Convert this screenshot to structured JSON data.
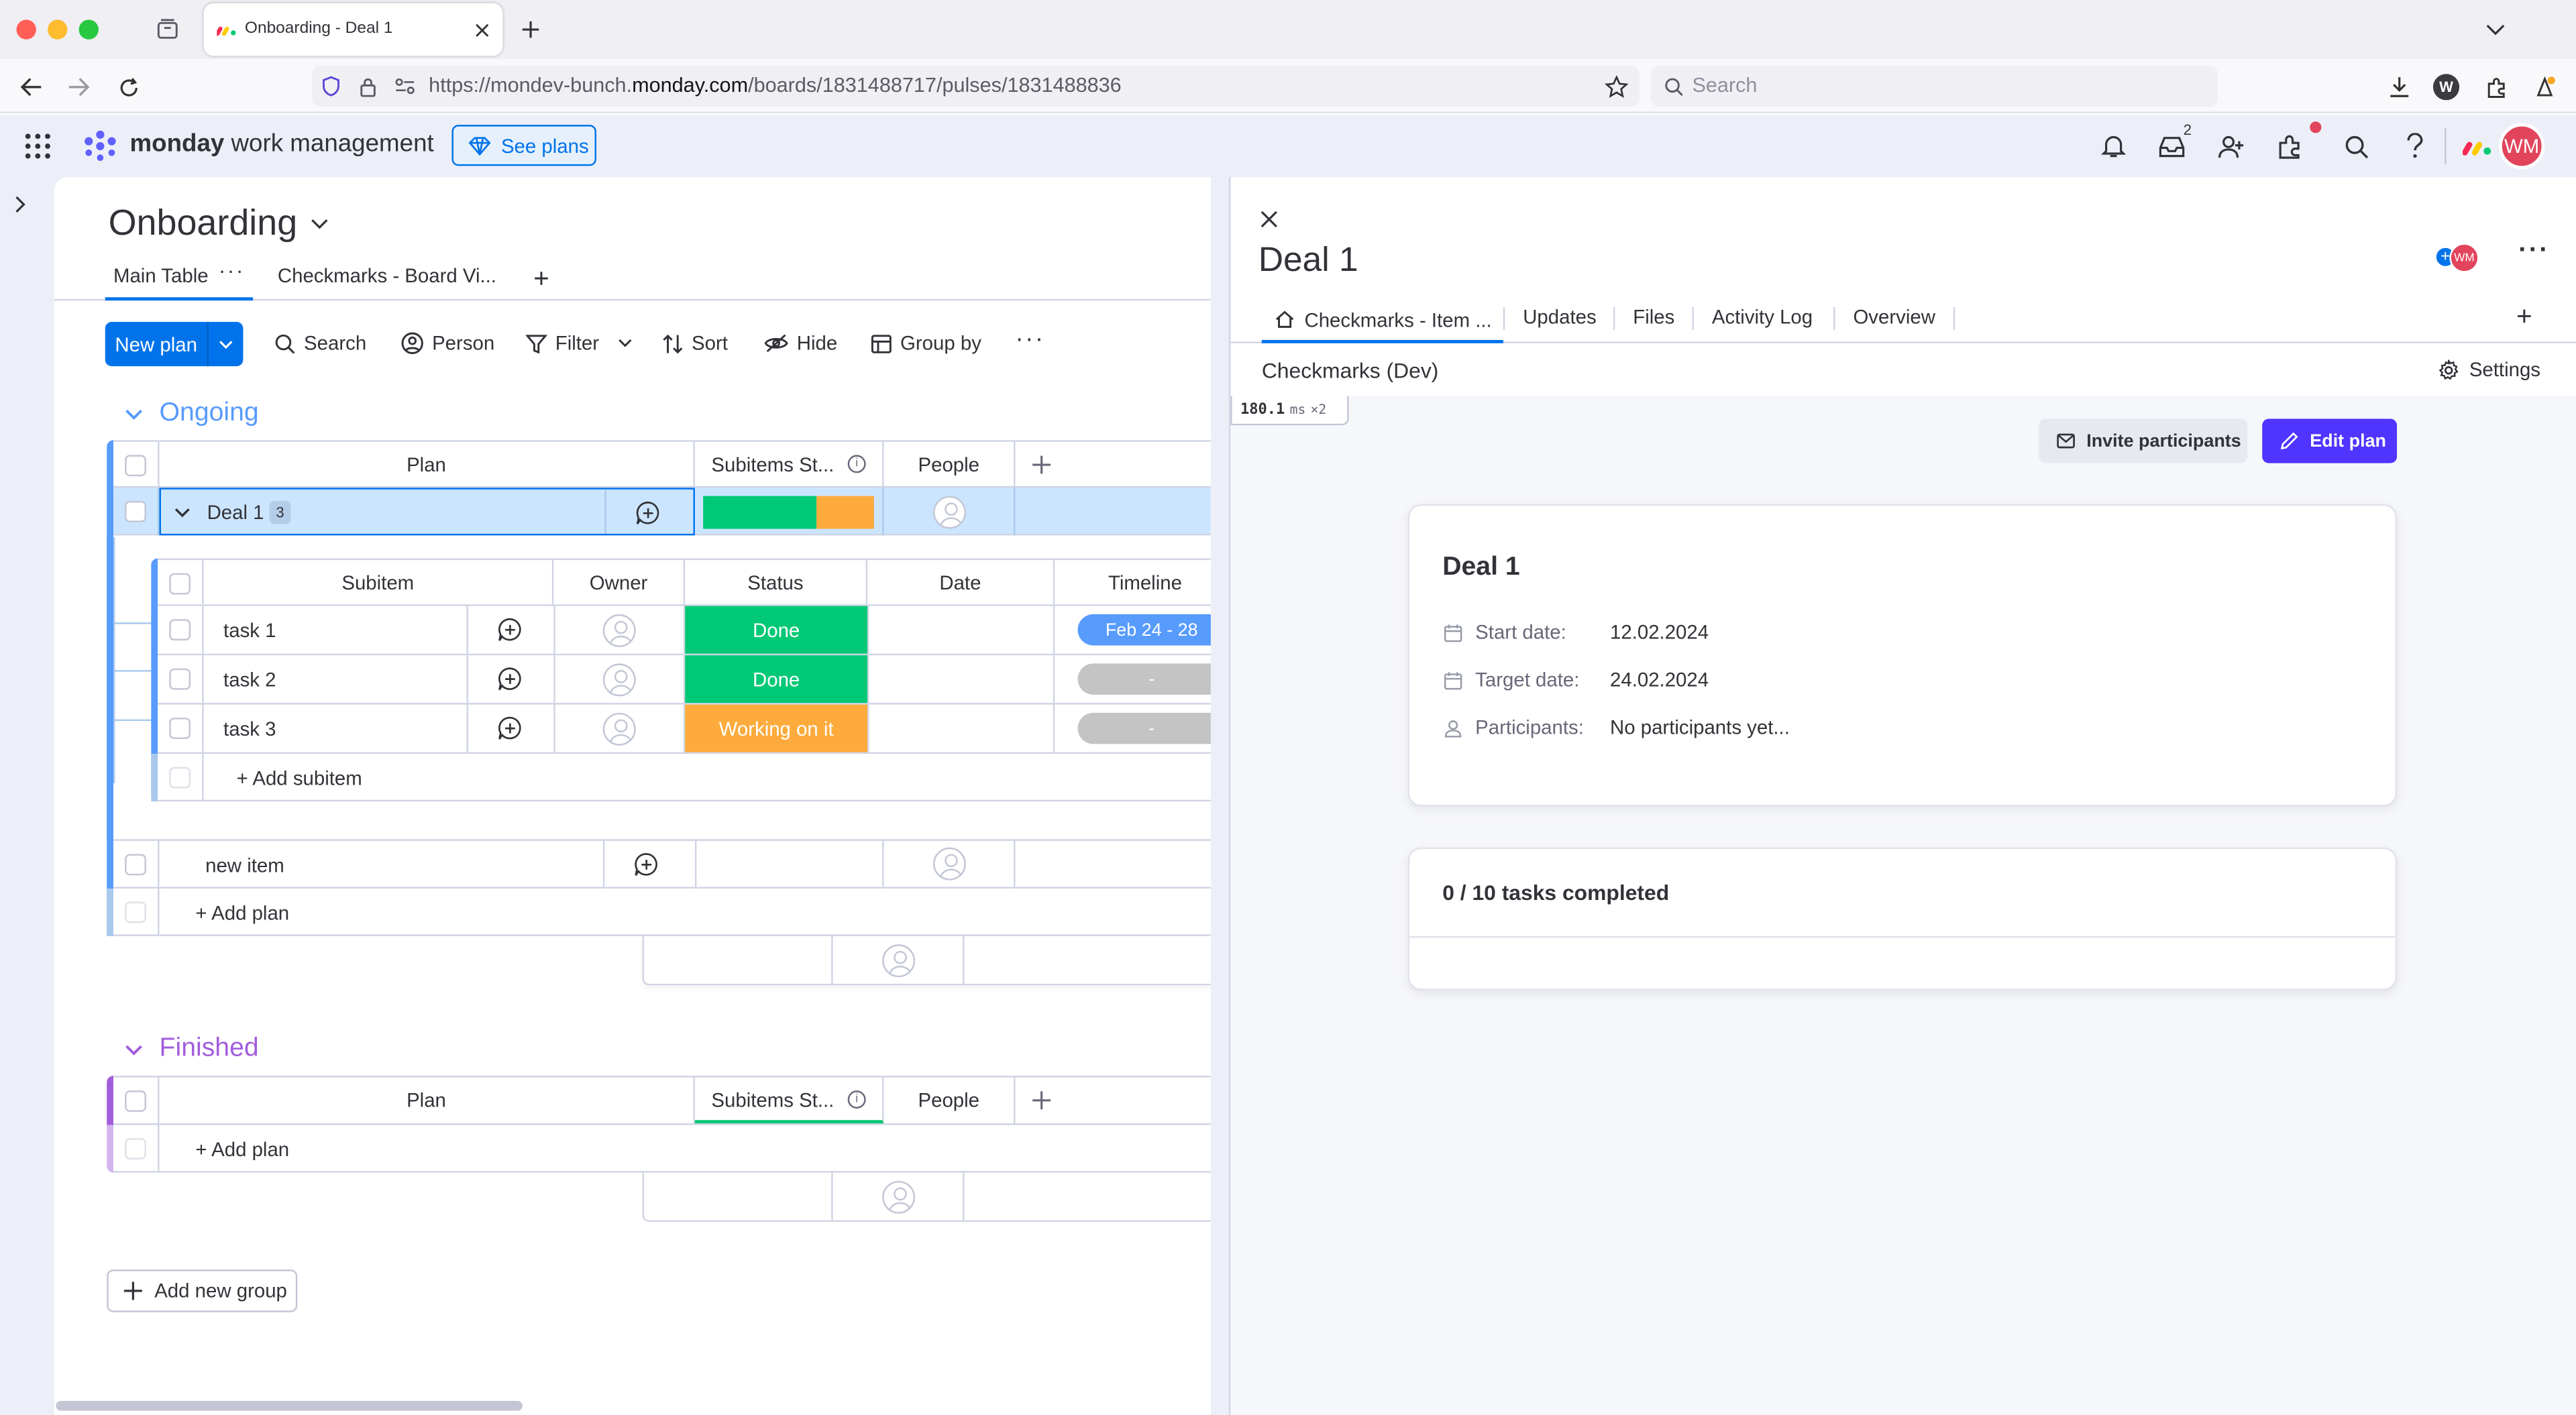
{
  "browser": {
    "tab_title": "Onboarding - Deal 1",
    "url_prefix": "https://mondev-bunch.",
    "url_domain": "monday.com",
    "url_path": "/boards/1831488717/pulses/1831488836",
    "search_placeholder": "Search",
    "inbox_badge": "2"
  },
  "header": {
    "brand_bold": "monday",
    "brand_rest": " work management",
    "see_plans": "See plans",
    "avatar_initials": "WM"
  },
  "board": {
    "title": "Onboarding",
    "views": [
      {
        "label": "Main Table"
      },
      {
        "label": "Checkmarks - Board Vi..."
      }
    ],
    "toolbar": {
      "new_plan": "New plan",
      "search": "Search",
      "person": "Person",
      "filter": "Filter",
      "sort": "Sort",
      "hide": "Hide",
      "group_by": "Group by"
    },
    "groups": [
      {
        "name": "Ongoing",
        "color": "#579bfc",
        "columns": {
          "plan": "Plan",
          "subitems_status": "Subitems St...",
          "people": "People"
        },
        "items": [
          {
            "name": "Deal 1",
            "subitem_count": "3"
          },
          {
            "name": "new item"
          }
        ],
        "add_plan": "+ Add plan"
      },
      {
        "name": "Finished",
        "color": "#a25ddc",
        "columns": {
          "plan": "Plan",
          "subitems_status": "Subitems St...",
          "people": "People"
        },
        "add_plan": "+ Add plan"
      }
    ],
    "subitems": {
      "columns": {
        "subitem": "Subitem",
        "owner": "Owner",
        "status": "Status",
        "date": "Date",
        "timeline": "Timeline"
      },
      "rows": [
        {
          "name": "task 1",
          "status": "Done",
          "status_color": "#00c875",
          "timeline": "Feb 24 - 28"
        },
        {
          "name": "task 2",
          "status": "Done",
          "status_color": "#00c875",
          "timeline": "-"
        },
        {
          "name": "task 3",
          "status": "Working on it",
          "status_color": "#fdab3d",
          "timeline": "-"
        }
      ],
      "add_subitem": "+ Add subitem"
    },
    "add_group": "Add new group"
  },
  "panel": {
    "title": "Deal 1",
    "tabs": [
      {
        "label": "Checkmarks - Item ..."
      },
      {
        "label": "Updates"
      },
      {
        "label": "Files"
      },
      {
        "label": "Activity Log"
      },
      {
        "label": "Overview"
      }
    ],
    "app_title": "Checkmarks (Dev)",
    "settings": "Settings",
    "perf_value": "180.1",
    "perf_unit": "ms",
    "perf_mult": "×2",
    "invite": "Invite participants",
    "edit_plan": "Edit plan",
    "card": {
      "title": "Deal 1",
      "start_label": "Start date:",
      "start_value": "12.02.2024",
      "target_label": "Target date:",
      "target_value": "24.02.2024",
      "participants_label": "Participants:",
      "participants_value": "No participants yet..."
    },
    "tasks_completed": "0 / 10 tasks completed"
  },
  "colors": {
    "accent": "#0073ea",
    "purple_button": "#5034ff",
    "done": "#00c875",
    "working": "#fdab3d",
    "selected_row": "#cce5ff"
  }
}
